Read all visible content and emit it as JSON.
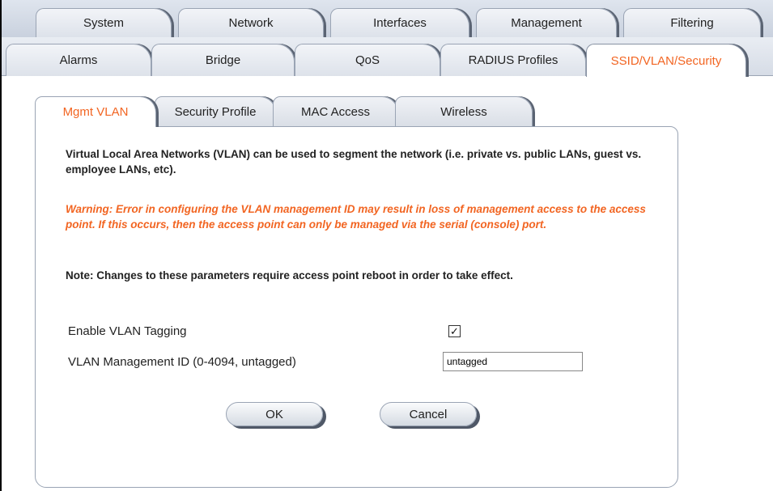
{
  "top_tabs": {
    "row1": [
      "System",
      "Network",
      "Interfaces",
      "Management",
      "Filtering"
    ],
    "row2": [
      "Alarms",
      "Bridge",
      "QoS",
      "RADIUS Profiles",
      "SSID/VLAN/Security"
    ]
  },
  "sub_tabs": [
    "Mgmt VLAN",
    "Security Profile",
    "MAC Access",
    "Wireless"
  ],
  "content": {
    "intro": "Virtual Local Area Networks (VLAN) can be used to segment the network (i.e. private vs. public LANs, guest vs. employee LANs, etc).",
    "warning": "Warning: Error in configuring the VLAN management ID may result in loss of management access to the access point. If this occurs, then the access point can only be managed via the serial (console) port.",
    "note": "Note: Changes to these parameters require access point reboot in order to take effect."
  },
  "form": {
    "enable_tagging_label": "Enable VLAN Tagging",
    "enable_tagging_checked": true,
    "check_glyph": "☑",
    "mgmt_id_label": "VLAN Management ID (0-4094, untagged)",
    "mgmt_id_value": "untagged"
  },
  "buttons": {
    "ok": "OK",
    "cancel": "Cancel"
  },
  "colors": {
    "accent": "#f26522",
    "tab_bg": "#dde2ea",
    "border": "#9aa4b4"
  }
}
